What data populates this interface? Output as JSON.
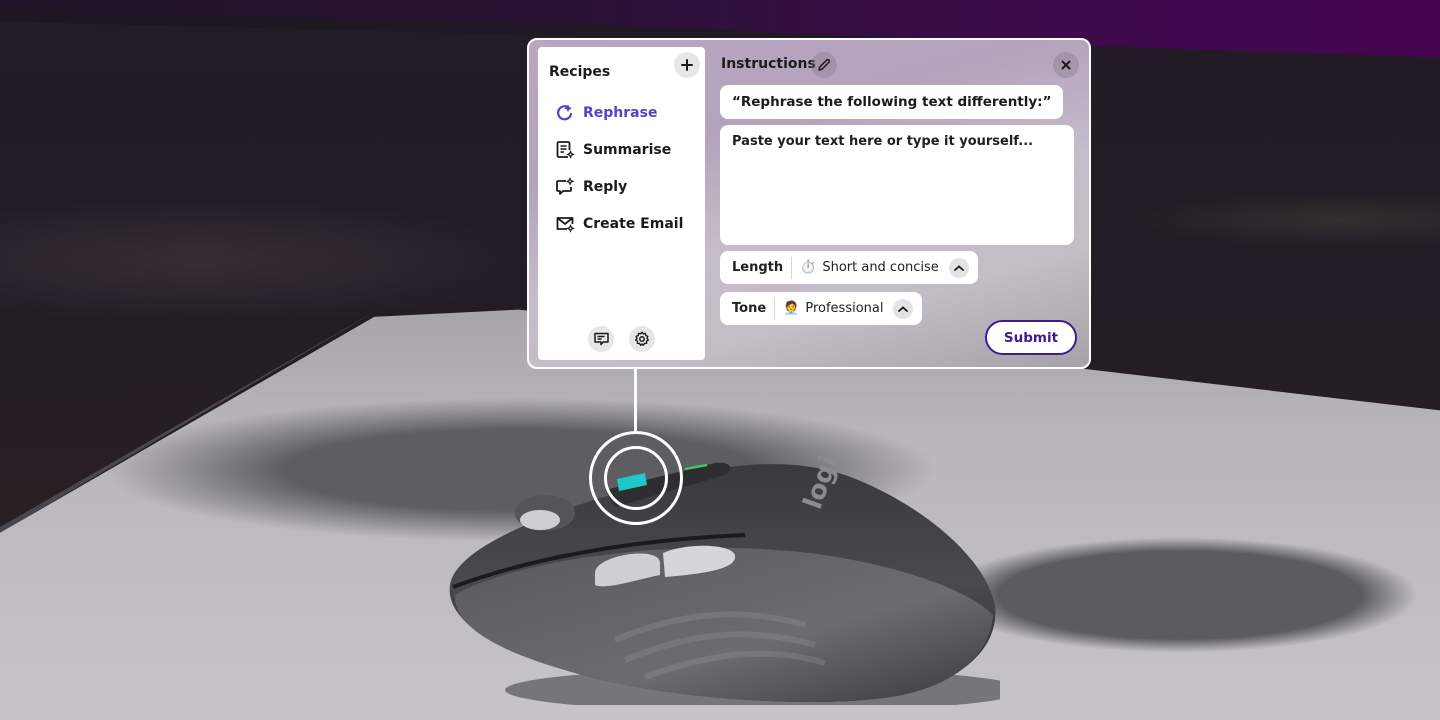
{
  "panel": {
    "recipes": {
      "title": "Recipes",
      "add_icon": "plus-icon",
      "items": [
        {
          "label": "Rephrase",
          "icon": "rephrase-refresh-icon",
          "active": true
        },
        {
          "label": "Summarise",
          "icon": "document-summary-icon",
          "active": false
        },
        {
          "label": "Reply",
          "icon": "reply-chat-icon",
          "active": false
        },
        {
          "label": "Create Email",
          "icon": "email-sparkle-icon",
          "active": false
        }
      ],
      "footer_icons": [
        "feedback-icon",
        "gear-icon"
      ]
    },
    "instructions": {
      "title": "Instructions",
      "edit_icon": "pencil-icon",
      "close_icon": "close-icon",
      "prompt_text": "“Rephrase the following text differently:”",
      "text_input": {
        "value": "",
        "placeholder": "Paste your text here or type it yourself..."
      },
      "length": {
        "label": "Length",
        "emoji": "⏱️",
        "value": "Short and concise"
      },
      "tone": {
        "label": "Tone",
        "emoji": "🧑‍💼",
        "value": "Professional"
      },
      "submit_label": "Submit"
    }
  },
  "colors": {
    "accent": "#5b3ec8",
    "submit_border": "#3b1d8f",
    "mouse_button_highlight": "#1fc7c9",
    "mouse_indicator": "#3ec46a"
  }
}
